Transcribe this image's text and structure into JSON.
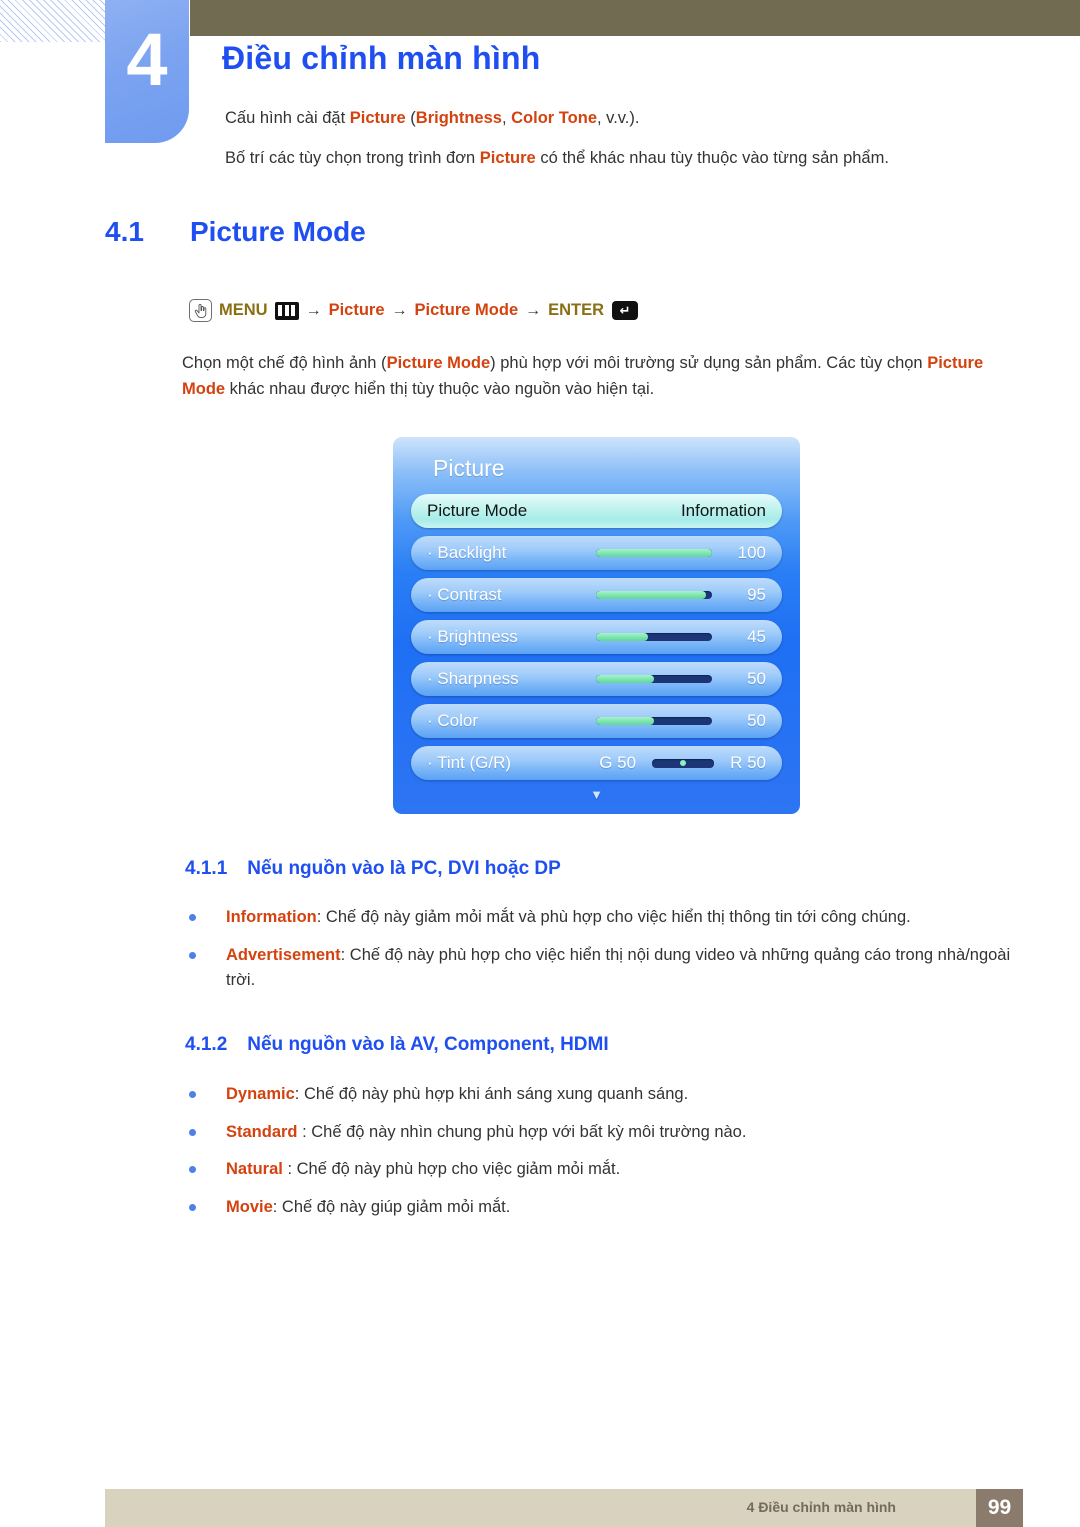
{
  "chapter": {
    "number": "4",
    "title": "Điều chỉnh màn hình",
    "intro_line_1_a": "Cấu hình cài đặt ",
    "intro_line_1_kw1": "Picture",
    "intro_line_1_b": " (",
    "intro_line_1_kw2": "Brightness",
    "intro_line_1_c": ", ",
    "intro_line_1_kw3": "Color Tone",
    "intro_line_1_d": ", v.v.).",
    "intro_line_2_a": "Bố trí các tùy chọn trong trình đơn ",
    "intro_line_2_kw": "Picture",
    "intro_line_2_b": " có thể khác nhau tùy thuộc vào từng sản phẩm."
  },
  "section": {
    "number": "4.1",
    "title": "Picture Mode"
  },
  "menu_path": {
    "hand_icon": "hand-pointer-icon",
    "menu_label": "MENU",
    "menu_icon": "menu-bars-icon",
    "arrow1": "→",
    "item1": "Picture",
    "arrow2": "→",
    "item2": "Picture Mode",
    "arrow3": "→",
    "enter_label": "ENTER",
    "enter_icon": "enter-return-icon",
    "enter_glyph": "↵"
  },
  "paragraph": {
    "a": "Chọn một chế độ hình ảnh (",
    "kw1": "Picture Mode",
    "b": ") phù hợp với môi trường sử dụng sản phẩm. Các tùy chọn ",
    "kw2": "Picture Mode",
    "c": " khác nhau được hiển thị tùy thuộc vào nguồn vào hiện tại."
  },
  "osd": {
    "title": "Picture",
    "selected_row": {
      "label": "Picture Mode",
      "value": "Information"
    },
    "rows": [
      {
        "label": "· Backlight",
        "value": "100",
        "fill_percent": 100,
        "type": "slider"
      },
      {
        "label": "· Contrast",
        "value": "95",
        "fill_percent": 95,
        "type": "slider"
      },
      {
        "label": "· Brightness",
        "value": "45",
        "fill_percent": 45,
        "type": "slider"
      },
      {
        "label": "· Sharpness",
        "value": "50",
        "fill_percent": 50,
        "type": "slider"
      },
      {
        "label": "· Color",
        "value": "50",
        "fill_percent": 50,
        "type": "slider"
      }
    ],
    "tint_row": {
      "label": "· Tint (G/R)",
      "left_value": "G 50",
      "right_value": "R 50"
    },
    "more_indicator": "▼"
  },
  "subsection_1": {
    "number": "4.1.1",
    "title": "Nếu nguồn vào là PC, DVI hoặc DP",
    "bullets": [
      {
        "kw": "Information",
        "rest": ": Chế độ này giảm mỏi mắt và phù hợp cho việc hiển thị thông tin tới công chúng."
      },
      {
        "kw": "Advertisement",
        "rest": ": Chế độ này phù hợp cho việc hiển thị nội dung video và những quảng cáo trong nhà/ngoài trời."
      }
    ]
  },
  "subsection_2": {
    "number": "4.1.2",
    "title": "Nếu nguồn vào là AV, Component, HDMI",
    "bullets": [
      {
        "kw": "Dynamic",
        "rest": ": Chế độ này phù hợp khi ánh sáng xung quanh sáng."
      },
      {
        "kw": "Standard",
        "rest": " : Chế độ này nhìn chung phù hợp với bất kỳ môi trường nào."
      },
      {
        "kw": "Natural",
        "rest": " : Chế độ này phù hợp cho việc giảm mỏi mắt."
      },
      {
        "kw": "Movie",
        "rest": ": Chế độ này giúp giảm mỏi mắt."
      }
    ]
  },
  "footer": {
    "text": "4 Điều chỉnh màn hình",
    "page": "99"
  },
  "colors": {
    "accent_blue": "#1f4ff0",
    "keyword_red": "#d4430f",
    "menu_olive": "#8a6f15",
    "header_olive": "#716b51",
    "footer_beige": "#d8d2bf",
    "footer_page_box": "#8a7b6d"
  }
}
